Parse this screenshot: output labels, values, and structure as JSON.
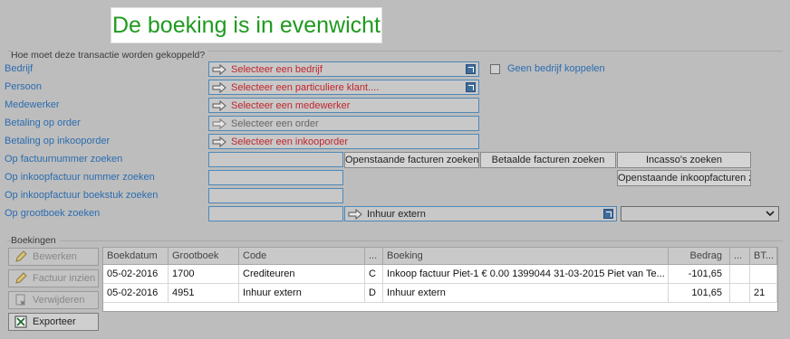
{
  "banner": "De boeking is in evenwicht",
  "link_section": {
    "title": "Hoe moet deze transactie worden gekoppeld?",
    "rows": [
      {
        "label": "Bedrijf",
        "value": "Selecteer een bedrijf"
      },
      {
        "label": "Persoon",
        "value": "Selecteer een particuliere klant...."
      },
      {
        "label": "Medewerker",
        "value": "Selecteer een medewerker"
      },
      {
        "label": "Betaling op order",
        "value": "Selecteer een order"
      },
      {
        "label": "Betaling op inkooporder",
        "value": "Selecteer een inkooporder"
      },
      {
        "label": "Op factuurnummer zoeken"
      },
      {
        "label": "Op inkoopfactuur nummer zoeken"
      },
      {
        "label": "Op inkoopfactuur boekstuk zoeken"
      },
      {
        "label": "Op grootboek zoeken",
        "value": "Inhuur extern"
      }
    ],
    "no_company_label": "Geen bedrijf koppelen",
    "buttons": {
      "open_invoices": "Openstaande facturen zoeken",
      "paid_invoices": "Betaalde facturen zoeken",
      "direct_debits": "Incasso's zoeken",
      "open_purchase_invoices": "Openstaande inkoopfacturen z"
    }
  },
  "bookings": {
    "title": "Boekingen",
    "actions": {
      "edit": "Bewerken",
      "view_invoice": "Factuur inzien",
      "delete": "Verwijderen",
      "export": "Exporteer"
    },
    "columns": [
      "Boekdatum",
      "Grootboek",
      "Code",
      "...",
      "Boeking",
      "Bedrag",
      "...",
      "BT..."
    ],
    "rows": [
      [
        "05-02-2016",
        "1700",
        "Crediteuren",
        "C",
        "Inkoop factuur Piet-1 € 0.00 1399044 31-03-2015 Piet van Te...",
        "-101,65",
        "",
        ""
      ],
      [
        "05-02-2016",
        "4951",
        "Inhuur extern",
        "D",
        "Inhuur extern",
        "101,65",
        "",
        "21"
      ]
    ]
  },
  "icons": {
    "select_arrow": "arrow-right-icon",
    "popup": "open-popup-icon",
    "dropdown": "chevron-down-icon",
    "edit": "pencil-icon",
    "invoice": "pencil-icon",
    "delete": "delete-icon",
    "export": "excel-icon"
  }
}
